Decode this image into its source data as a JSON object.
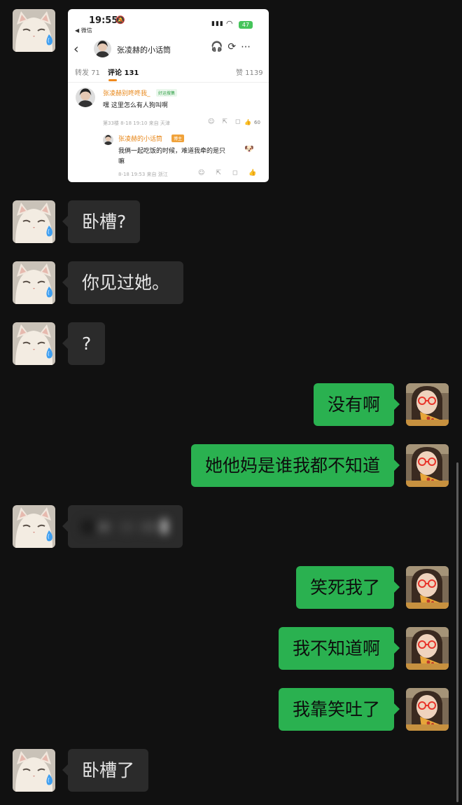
{
  "screenshot": {
    "status_time": "19:55",
    "status_app": "◀ 微信",
    "battery": "47",
    "nav_back": "‹",
    "nav_title": "张凌赫的小话筒",
    "nav_actions": "🎧⟳⋯",
    "tabs": [
      {
        "label": "转发 71"
      },
      {
        "label": "评论 131"
      },
      {
        "label": "赞 1139"
      }
    ],
    "comment": {
      "author": "张凌赫别咚咚我_",
      "tag": "好运搜集",
      "text": "嘿 这里怎么有人狗叫啊",
      "meta": "第33楼 8-18 19:10 来自 天津",
      "like_count": "60"
    },
    "reply": {
      "author": "张凌赫的小话筒",
      "tag": "博主",
      "text_line1": "我俩一起吃饭的时候，难道我牵的是只",
      "text_line2": "嘛",
      "meta": "8-18 19:53 来自 浙江"
    }
  },
  "messages": [
    {
      "side": "in",
      "text": "卧槽?"
    },
    {
      "side": "in",
      "text": "你见过她。"
    },
    {
      "side": "in",
      "text": "?"
    },
    {
      "side": "out",
      "text": "没有啊"
    },
    {
      "side": "out",
      "text": "她他妈是谁我都不知道"
    },
    {
      "side": "in",
      "text": ""
    },
    {
      "side": "out",
      "text": "笑死我了"
    },
    {
      "side": "out",
      "text": "我不知道啊"
    },
    {
      "side": "out",
      "text": "我靠笑吐了"
    },
    {
      "side": "in",
      "text": "卧槽了"
    }
  ],
  "avatars": {
    "incoming": "cat-crying-icon",
    "outgoing": "girl-red-glasses-icon"
  },
  "colors": {
    "background": "#111111",
    "incoming_bubble": "#2b2b2b",
    "outgoing_bubble": "#2ab150",
    "tab_accent": "#f08a1e"
  }
}
